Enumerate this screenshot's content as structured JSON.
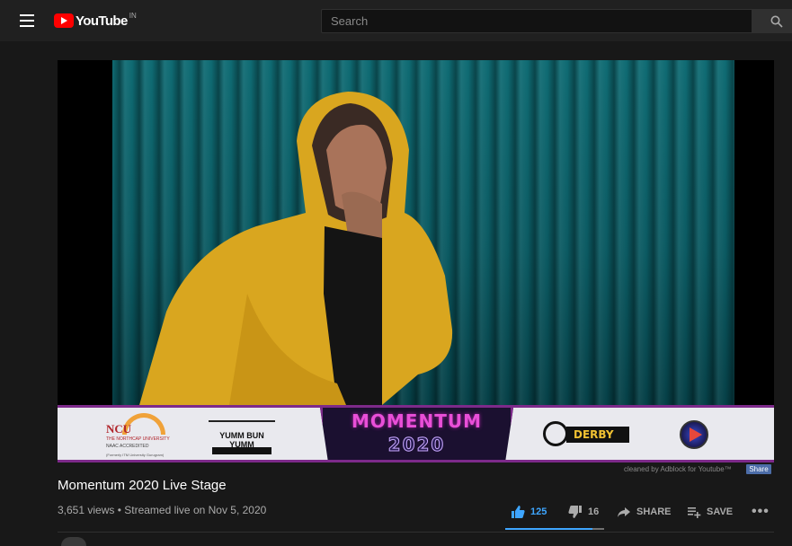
{
  "header": {
    "logo_text": "YouTube",
    "country_code": "IN",
    "search_placeholder": "Search"
  },
  "video": {
    "banner": {
      "headline": "MOMENTUM",
      "year": "2020",
      "sponsors": {
        "ncu_name": "NCU",
        "ncu_line": "THE NORTHCAP UNIVERSITY",
        "ncu_sub": "NAAC ACCREDITED",
        "ncu_former": "(Formerly ITM University Gurugram)",
        "ybun": "YUMM BUN YUMM",
        "derby": "DERBY"
      }
    },
    "adblock_note": "cleaned by Adblock for Youtube™",
    "adblock_share": "Share"
  },
  "info": {
    "title": "Momentum 2020 Live Stage",
    "meta": "3,651 views • Streamed live on Nov 5, 2020",
    "likes": "125",
    "dislikes": "16",
    "share_label": "SHARE",
    "save_label": "SAVE",
    "more_label": "•••",
    "like_ratio": 0.886
  },
  "colors": {
    "accent": "#3ea6ff",
    "brand_red": "#ff0000",
    "banner_purple": "#7d2a8a"
  }
}
